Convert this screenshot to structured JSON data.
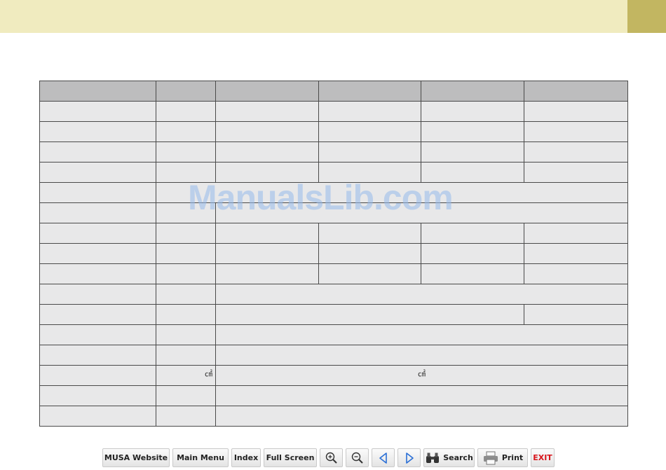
{
  "header": {
    "bar_color": "#f0ebbf",
    "accent_color": "#c2b661"
  },
  "watermark": {
    "text": "ManualsLib.com"
  },
  "table": {
    "unit_symbol": "㎠"
  },
  "toolbar": {
    "musa_website": "MUSA Website",
    "main_menu": "Main Menu",
    "index": "Index",
    "full_screen": "Full Screen",
    "zoom_in_icon": "zoom-in-icon",
    "zoom_out_icon": "zoom-out-icon",
    "prev_icon": "prev-page-icon",
    "next_icon": "next-page-icon",
    "search": "Search",
    "print": "Print",
    "exit": "EXIT",
    "exit_color": "#d8141b"
  }
}
